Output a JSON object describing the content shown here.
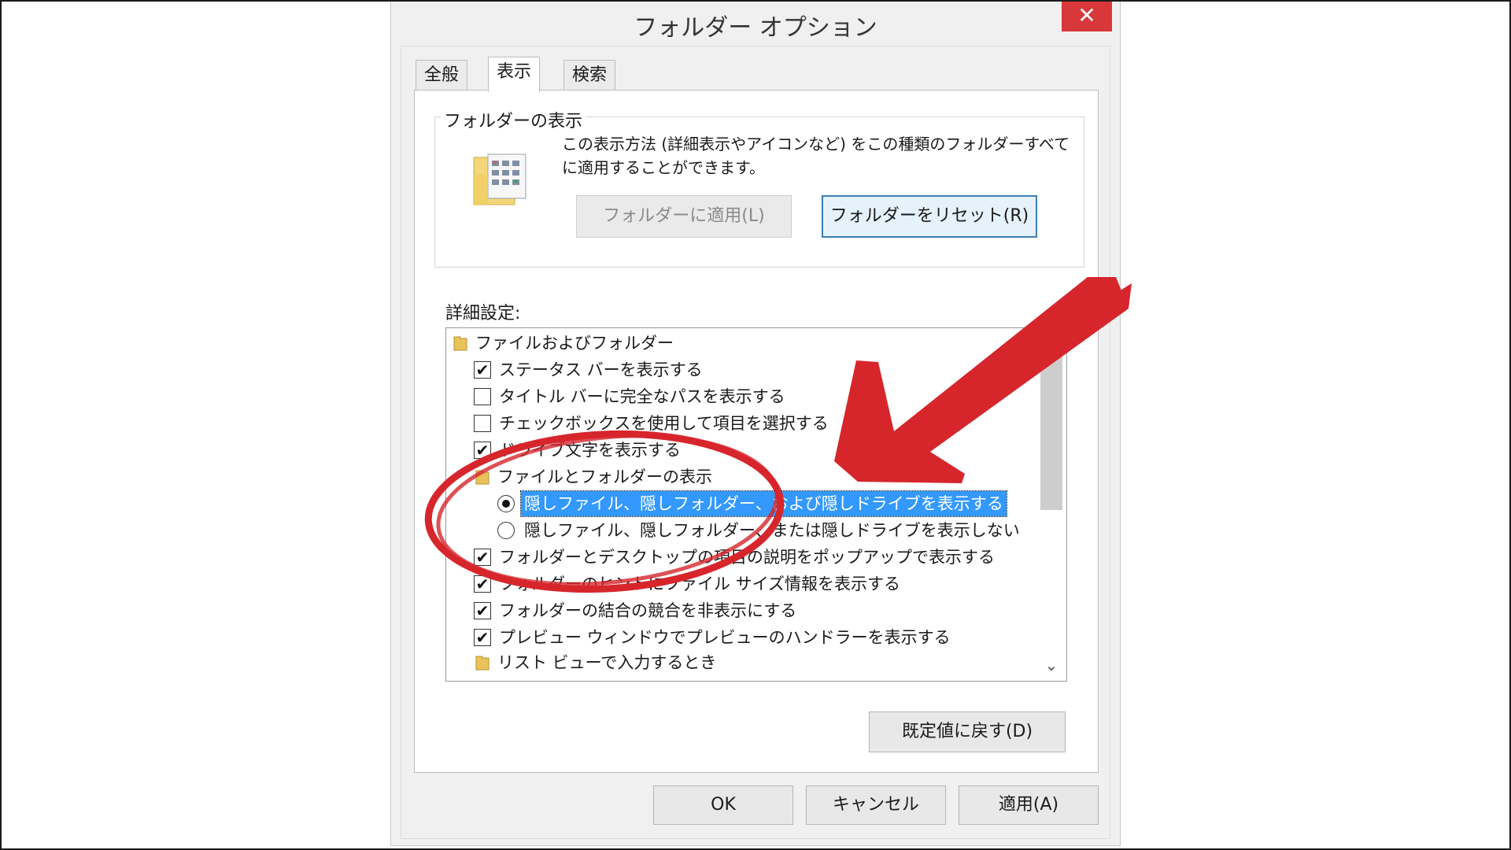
{
  "dialog": {
    "title": "フォルダー オプション",
    "close_glyph": "✕"
  },
  "tabs": [
    {
      "label": "全般",
      "active": false
    },
    {
      "label": "表示",
      "active": true
    },
    {
      "label": "検索",
      "active": false
    }
  ],
  "folder_view": {
    "group_label": "フォルダーの表示",
    "description": "この表示方法 (詳細表示やアイコンなど) をこの種類のフォルダーすべてに適用することができます。",
    "apply_button": "フォルダーに適用(L)",
    "reset_button": "フォルダーをリセット(R)"
  },
  "advanced": {
    "label": "詳細設定:",
    "items": [
      {
        "type": "folder",
        "label": "ファイルおよびフォルダー"
      },
      {
        "type": "checkbox",
        "checked": true,
        "label": "ステータス バーを表示する"
      },
      {
        "type": "checkbox",
        "checked": false,
        "label": "タイトル バーに完全なパスを表示する"
      },
      {
        "type": "checkbox",
        "checked": false,
        "label": "チェックボックスを使用して項目を選択する"
      },
      {
        "type": "checkbox",
        "checked": true,
        "label": "ドライブ文字を表示する"
      },
      {
        "type": "folder",
        "label": "ファイルとフォルダーの表示"
      },
      {
        "type": "radio",
        "checked": true,
        "selected": true,
        "label": "隠しファイル、隠しフォルダー、および隠しドライブを表示する"
      },
      {
        "type": "radio",
        "checked": false,
        "label": "隠しファイル、隠しフォルダー、または隠しドライブを表示しない"
      },
      {
        "type": "checkbox",
        "checked": true,
        "label": "フォルダーとデスクトップの項目の説明をポップアップで表示する"
      },
      {
        "type": "checkbox",
        "checked": true,
        "label": "フォルダーのヒントにファイル サイズ情報を表示する"
      },
      {
        "type": "checkbox",
        "checked": true,
        "label": "フォルダーの結合の競合を非表示にする"
      },
      {
        "type": "checkbox",
        "checked": true,
        "label": "プレビュー ウィンドウでプレビューのハンドラーを表示する"
      },
      {
        "type": "folder",
        "label": "リスト ビューで入力するとき"
      }
    ],
    "restore_button": "既定値に戻す(D)"
  },
  "footer": {
    "ok": "OK",
    "cancel": "キャンセル",
    "apply": "適用(A)"
  },
  "colors": {
    "annotation_red": "#d6262c",
    "selection_blue": "#3399ff",
    "close_red": "#d9383a"
  }
}
